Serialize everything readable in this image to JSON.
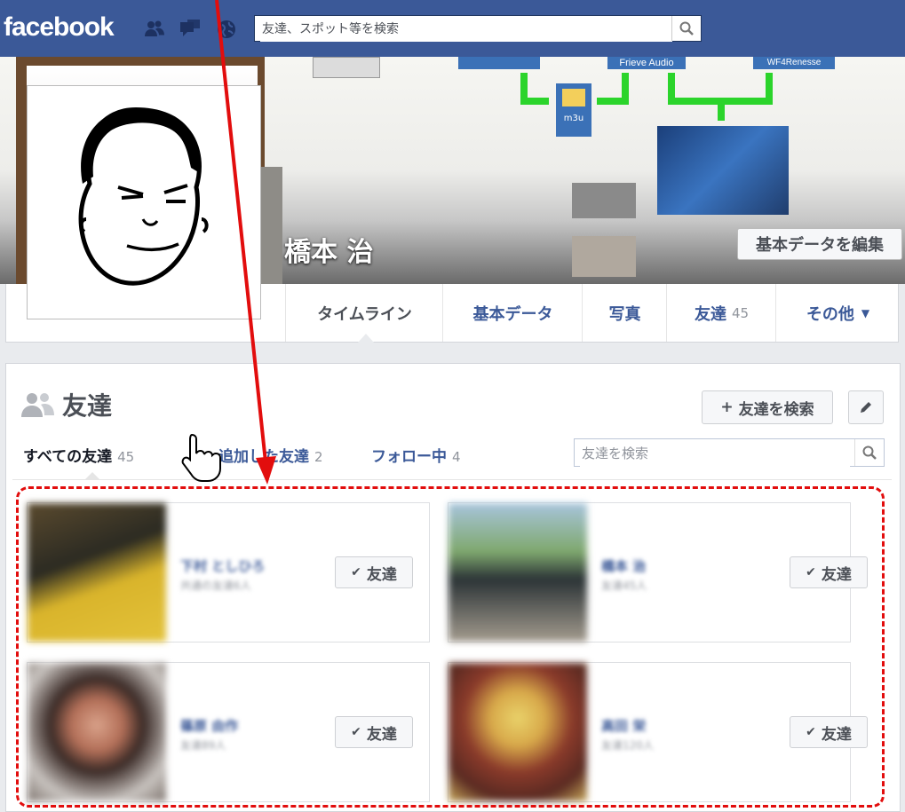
{
  "topbar": {
    "logo": "facebook",
    "search_placeholder": "友達、スポット等を検索",
    "icons": [
      "friends-icon",
      "messages-icon",
      "notifications-globe-icon",
      "search-icon"
    ]
  },
  "cover": {
    "diagram_labels": [
      "Frieve Audio",
      "m3u",
      "WF4Renesse"
    ],
    "profile_name": "橋本 治",
    "edit_button": "基本データを編集"
  },
  "tabs": [
    {
      "label": "タイムライン",
      "active": true
    },
    {
      "label": "基本データ"
    },
    {
      "label": "写真"
    },
    {
      "label": "友達",
      "count": "45"
    },
    {
      "label": "その他",
      "caret": "▼"
    }
  ],
  "friends": {
    "title": "友達",
    "find_button": "友達を検索",
    "find_button_plus": "+",
    "filters": [
      {
        "label": "すべての友達",
        "count": "45"
      },
      {
        "label": "追加した友達",
        "count": "2"
      },
      {
        "label": "フォロー中",
        "count": "4"
      }
    ],
    "search_placeholder": "友達を検索",
    "cards": [
      {
        "name": "下村 としひろ",
        "sub": "共通の友達6人",
        "button": "友達"
      },
      {
        "name": "橋本 治",
        "sub": "友達45人",
        "button": "友達"
      },
      {
        "name": "篠原 由作",
        "sub": "友達89人",
        "button": "友達"
      },
      {
        "name": "高田 栄",
        "sub": "友達120人",
        "button": "友達"
      }
    ]
  },
  "colors": {
    "topbar": "#3b5998",
    "link": "#3b5998",
    "annotation_red": "#e20d0d"
  }
}
